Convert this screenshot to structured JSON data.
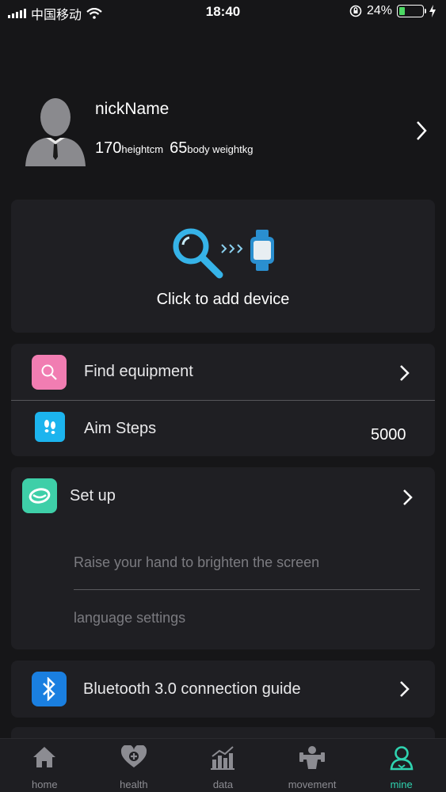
{
  "status_bar": {
    "carrier": "中国移动",
    "time": "18:40",
    "battery_percent": "24%",
    "battery_level": 0.24,
    "icons": [
      "signal-icon",
      "wifi-icon",
      "orientation-lock-icon",
      "battery-icon",
      "charging-icon"
    ]
  },
  "profile": {
    "nickname": "nickName",
    "height_value": "170",
    "height_unit": "heightcm",
    "weight_value": "65",
    "weight_unit": "body weightkg"
  },
  "add_device": {
    "label": "Click to add device",
    "icons": [
      "search-icon",
      "arrows-icon",
      "watch-icon"
    ]
  },
  "menu": {
    "find_equipment": "Find equipment",
    "aim_steps": "Aim Steps",
    "aim_steps_value": "5000",
    "set_up": "Set up",
    "raise_hand": "Raise your hand to brighten the screen",
    "language_settings": "language settings",
    "bluetooth_guide": "Bluetooth 3.0 connection guide"
  },
  "tabs": [
    {
      "label": "home",
      "icon": "home-icon",
      "active": false
    },
    {
      "label": "health",
      "icon": "heart-plus-icon",
      "active": false
    },
    {
      "label": "data",
      "icon": "chart-icon",
      "active": false
    },
    {
      "label": "movement",
      "icon": "dumbbell-icon",
      "active": false
    },
    {
      "label": "mine",
      "icon": "user-icon",
      "active": true
    }
  ],
  "colors": {
    "background": "#161618",
    "card": "#1f1f23",
    "accent": "#2fd3b0",
    "find_icon": "#f17db2",
    "steps_icon": "#1cb4ee",
    "setup_icon": "#3ecfa8",
    "bluetooth_icon": "#1a7fe0",
    "search_blue": "#36b3e8"
  }
}
